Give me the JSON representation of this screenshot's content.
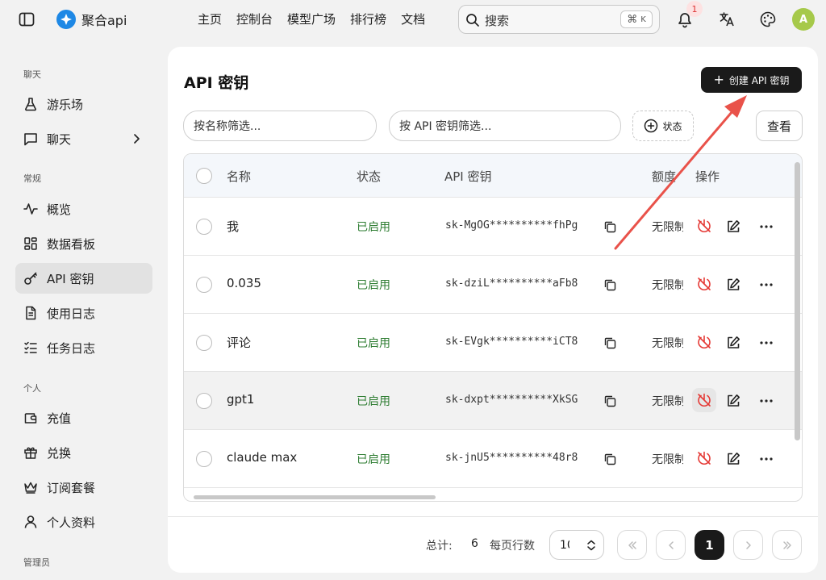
{
  "app": {
    "name": "聚合api"
  },
  "nav": [
    "主页",
    "控制台",
    "模型广场",
    "排行榜",
    "文档"
  ],
  "search": {
    "placeholder": "搜索",
    "shortcut_symbol": "⌘",
    "shortcut_key": "K"
  },
  "notifications": {
    "count": "1"
  },
  "user": {
    "initial": "A"
  },
  "sidebar": {
    "sections": {
      "chat": "聊天",
      "general": "常规",
      "personal": "个人",
      "admin": "管理员"
    },
    "items": {
      "playground": "游乐场",
      "chat": "聊天",
      "overview": "概览",
      "dashboard": "数据看板",
      "api_keys": "API 密钥",
      "usage_logs": "使用日志",
      "task_logs": "任务日志",
      "topup": "充值",
      "redeem": "兑换",
      "subscription": "订阅套餐",
      "profile": "个人资料"
    }
  },
  "page": {
    "title": "API 密钥",
    "create_button": "创建 API 密钥",
    "filter_name_placeholder": "按名称筛选...",
    "filter_key_placeholder": "按 API 密钥筛选...",
    "status_button": "状态",
    "view_button": "查看"
  },
  "table": {
    "headers": {
      "name": "名称",
      "status": "状态",
      "key": "API 密钥",
      "quota": "额度",
      "actions": "操作"
    },
    "rows": [
      {
        "name": "我",
        "status": "已启用",
        "key": "sk-MgOG**********fhPg",
        "quota": "无限制"
      },
      {
        "name": "0.035",
        "status": "已启用",
        "key": "sk-dziL**********aFb8",
        "quota": "无限制"
      },
      {
        "name": "评论",
        "status": "已启用",
        "key": "sk-EVgk**********iCT8",
        "quota": "无限制"
      },
      {
        "name": "gpt1",
        "status": "已启用",
        "key": "sk-dxpt**********XkSG",
        "quota": "无限制"
      },
      {
        "name": "claude max",
        "status": "已启用",
        "key": "sk-jnU5**********48r8",
        "quota": "无限制"
      }
    ]
  },
  "pagination": {
    "total_label": "总计:",
    "total_value": "6",
    "per_page_label": "每页行数",
    "per_page_value": "10",
    "current_page": "1"
  },
  "colors": {
    "accent": "#1a1a1a",
    "enabled": "#2e7d32",
    "disable_icon": "#e53935",
    "annotation_arrow": "#e9524a"
  }
}
